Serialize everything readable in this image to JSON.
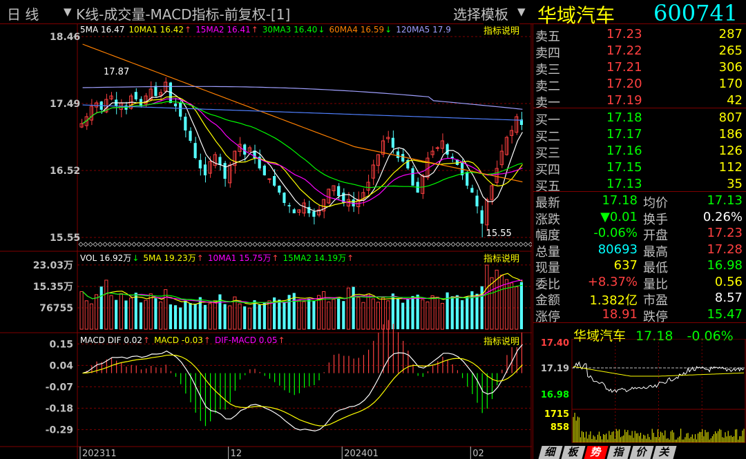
{
  "header": {
    "period_label": "日  线",
    "indicator_title": "K线-成交量-MACD指标-前复权-[1]",
    "template_label": "选择模板",
    "stock_name": "华域汽车",
    "stock_code": "600741"
  },
  "help_label": "指标说明",
  "price_panel": {
    "legend": [
      {
        "text": "5MA 16.47",
        "color": "#ffffff",
        "arrow": ""
      },
      {
        "text": "10MA1 16.42",
        "color": "#ffff00",
        "arrow": "↑"
      },
      {
        "text": "15MA2 16.41",
        "color": "#ff00ff",
        "arrow": "↑"
      },
      {
        "text": "30MA3 16.40",
        "color": "#00ff00",
        "arrow": "↓"
      },
      {
        "text": "60MA4 16.59",
        "color": "#ff8000",
        "arrow": "↓"
      },
      {
        "text": "120MA5 17.9",
        "color": "#a0a0ff",
        "arrow": ""
      }
    ],
    "annot_high": "17.87",
    "annot_low": "15.55"
  },
  "volume_panel": {
    "legend": [
      {
        "text": "VOL 16.92万",
        "color": "#ffffff",
        "arrow": "↓"
      },
      {
        "text": "5MA 19.23万",
        "color": "#ffff00",
        "arrow": "↑"
      },
      {
        "text": "10MA1 15.75万",
        "color": "#ff00ff",
        "arrow": "↑"
      },
      {
        "text": "15MA2 14.19万",
        "color": "#00ff00",
        "arrow": "↑"
      }
    ]
  },
  "macd_panel": {
    "legend": [
      {
        "text": "MACD DIF 0.02",
        "color": "#ffffff",
        "arrow": "↑"
      },
      {
        "text": "MACD -0.03",
        "color": "#ffff00",
        "arrow": "↑"
      },
      {
        "text": "DIF-MACD 0.05",
        "color": "#ff00ff",
        "arrow": "↑"
      }
    ]
  },
  "chart_data": [
    {
      "type": "candlestick",
      "title": "K线",
      "y_ticks": [
        "18.46",
        "17.49",
        "16.52",
        "15.55"
      ],
      "ylim": [
        15.55,
        18.46
      ],
      "x_ticks": [
        "202311",
        "12",
        "202401",
        "02"
      ],
      "annotations": [
        {
          "label": "17.87"
        },
        {
          "label": "15.55"
        }
      ],
      "closes": [
        17.2,
        17.3,
        17.45,
        17.5,
        17.4,
        17.55,
        17.6,
        17.45,
        17.5,
        17.4,
        17.6,
        17.55,
        17.45,
        17.6,
        17.7,
        17.6,
        17.65,
        17.8,
        17.5,
        17.45,
        17.3,
        17.1,
        16.95,
        16.7,
        16.55,
        16.45,
        16.65,
        16.75,
        16.6,
        16.4,
        16.6,
        16.8,
        16.9,
        16.75,
        16.85,
        16.7,
        16.55,
        16.45,
        16.4,
        16.3,
        16.2,
        16.05,
        16.0,
        15.9,
        15.95,
        16.05,
        15.9,
        15.85,
        15.95,
        16.1,
        16.25,
        16.3,
        16.15,
        16.05,
        16.1,
        16.0,
        16.1,
        16.2,
        16.35,
        16.6,
        16.75,
        16.95,
        17.0,
        16.85,
        16.7,
        16.65,
        16.55,
        16.3,
        16.2,
        16.45,
        16.7,
        16.8,
        16.85,
        16.95,
        16.75,
        16.7,
        16.6,
        16.45,
        16.3,
        16.2,
        16.0,
        15.75,
        16.1,
        16.3,
        16.55,
        16.8,
        17.0,
        17.1,
        17.3,
        17.18
      ]
    },
    {
      "type": "bar",
      "title": "VOL",
      "y_ticks": [
        "23.03万",
        "15.35万",
        "76755"
      ],
      "ylim": [
        0,
        24.0
      ],
      "values": [
        13.5,
        10.2,
        9.1,
        12.4,
        15.3,
        17.6,
        12.1,
        10.5,
        12.8,
        10.3,
        11.2,
        13.1,
        9.6,
        10.4,
        12.7,
        11.1,
        9.8,
        14.2,
        8.9,
        8.6,
        7.8,
        10.2,
        9.4,
        9.1,
        11.5,
        8.7,
        9.2,
        10.3,
        12.5,
        9.0,
        8.4,
        11.6,
        9.1,
        8.2,
        7.6,
        10.4,
        8.8,
        9.5,
        10.2,
        11.4,
        10.6,
        9.8,
        12.3,
        13.0,
        10.4,
        9.9,
        11.0,
        10.2,
        12.1,
        13.5,
        9.8,
        10.7,
        11.2,
        10.1,
        14.8,
        15.2,
        11.4,
        9.6,
        12.6,
        10.9,
        9.7,
        11.3,
        10.2,
        12.8,
        11.1,
        9.5,
        10.8,
        11.9,
        12.4,
        10.6,
        9.8,
        12.0,
        11.5,
        9.3,
        13.2,
        11.8,
        12.2,
        10.4,
        11.6,
        13.6,
        12.7,
        15.4,
        23.0,
        18.5,
        21.2,
        19.4,
        17.8,
        16.6,
        15.2,
        16.9
      ],
      "ma5": 19.23,
      "ma10": 15.75,
      "ma15": 14.19
    },
    {
      "type": "line",
      "title": "MACD",
      "y_ticks": [
        "0.15",
        "0.04",
        "-0.07",
        "-0.18",
        "-0.29"
      ],
      "ylim": [
        -0.37,
        0.19
      ],
      "dif_final": 0.02,
      "dea_final": -0.03,
      "hist_final": 0.05
    }
  ],
  "order_book": {
    "asks": [
      {
        "label": "卖五",
        "price": "17.23",
        "vol": "287"
      },
      {
        "label": "卖四",
        "price": "17.22",
        "vol": "265"
      },
      {
        "label": "卖三",
        "price": "17.21",
        "vol": "306"
      },
      {
        "label": "卖二",
        "price": "17.20",
        "vol": "170"
      },
      {
        "label": "卖一",
        "price": "17.19",
        "vol": "42"
      }
    ],
    "bids": [
      {
        "label": "买一",
        "price": "17.18",
        "vol": "807"
      },
      {
        "label": "买二",
        "price": "17.17",
        "vol": "186"
      },
      {
        "label": "买三",
        "price": "17.16",
        "vol": "126"
      },
      {
        "label": "买四",
        "price": "17.15",
        "vol": "112"
      },
      {
        "label": "买五",
        "price": "17.13",
        "vol": "35"
      }
    ]
  },
  "stats": [
    {
      "l1": "最新",
      "v1": "17.18",
      "c1": "#00ff00",
      "l2": "均价",
      "v2": "17.13",
      "c2": "#00ff00"
    },
    {
      "l1": "涨跌",
      "v1": "▼0.01",
      "c1": "#00ff00",
      "l2": "换手",
      "v2": "0.26%",
      "c2": "#ffffff"
    },
    {
      "l1": "幅度",
      "v1": "-0.06%",
      "c1": "#00ff00",
      "l2": "开盘",
      "v2": "17.23",
      "c2": "#ff4040"
    },
    {
      "l1": "总量",
      "v1": "80693",
      "c1": "#00ffff",
      "l2": "最高",
      "v2": "17.28",
      "c2": "#ff4040"
    },
    {
      "l1": "现量",
      "v1": "637",
      "c1": "#ffff00",
      "l2": "最低",
      "v2": "16.98",
      "c2": "#00ff00"
    },
    {
      "l1": "委比",
      "v1": "+8.37%",
      "c1": "#ff4040",
      "l2": "量比",
      "v2": "0.56",
      "c2": "#ffff00"
    },
    {
      "l1": "金额",
      "v1": "1.382亿",
      "c1": "#ffff00",
      "l2": "市盈",
      "v2": "8.57",
      "c2": "#ffffff"
    },
    {
      "l1": "涨停",
      "v1": "18.91",
      "c1": "#ff4040",
      "l2": "跌停",
      "v2": "15.47",
      "c2": "#00ff00"
    }
  ],
  "mini_chart": {
    "name": "华域汽车",
    "price": "17.18",
    "change": "-0.06%",
    "y_ticks": [
      "17.40",
      "17.19",
      "16.98"
    ],
    "vol_ticks": [
      "1715",
      "858"
    ]
  },
  "tabs": [
    "细",
    "板",
    "势",
    "指",
    "价",
    "关"
  ],
  "active_tab": "势",
  "colors": {
    "up": "#ff4040",
    "down": "#54ffff",
    "grid": "#800000",
    "tick": "#c0c0c0"
  }
}
